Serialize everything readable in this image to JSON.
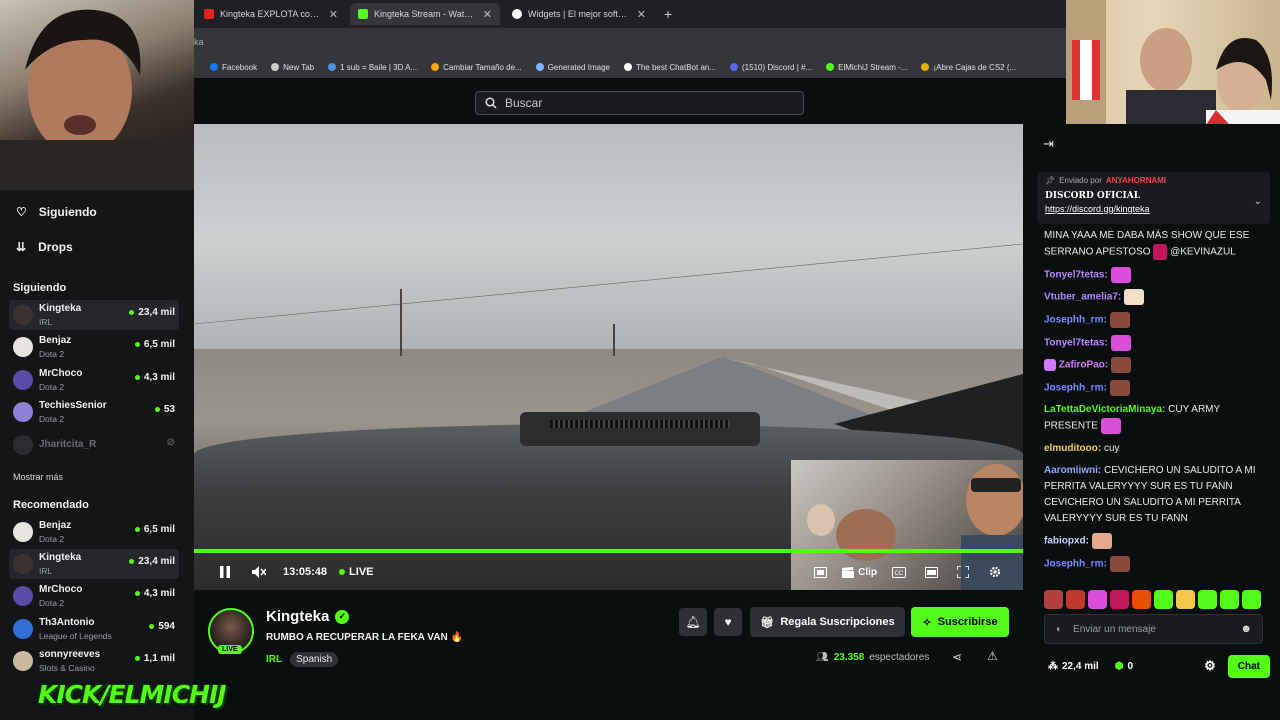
{
  "browser": {
    "tabs": [
      {
        "title": "Kingteka EXPLOTA con el Ñaja I",
        "favicon_color": "#e02424",
        "active": false
      },
      {
        "title": "Kingteka Stream - Watch Live o",
        "favicon_color": "#53fc18",
        "active": true
      },
      {
        "title": "Widgets | El mejor software par",
        "favicon_color": "#ffffff",
        "active": false
      }
    ],
    "url_fragment": "ka",
    "bookmarks": [
      {
        "label": "Facebook",
        "color": "#1877f2"
      },
      {
        "label": "New Tab",
        "color": "#cccccc"
      },
      {
        "label": "1 sub = Baile | 3D A...",
        "color": "#4a90e2"
      },
      {
        "label": "Cambiar Tamaño de...",
        "color": "#f2a900"
      },
      {
        "label": "Generated Image",
        "color": "#7fb2ff"
      },
      {
        "label": "The best ChatBot an...",
        "color": "#ffffff"
      },
      {
        "label": "(1510) Discord | #...",
        "color": "#5865f2"
      },
      {
        "label": "ElMichiJ Stream -...",
        "color": "#53fc18"
      },
      {
        "label": "¡Abre Cajas de CS2 (...",
        "color": "#e0b000"
      }
    ]
  },
  "search": {
    "placeholder": "Buscar"
  },
  "sidebar": {
    "following_label": "Siguiendo",
    "drops_label": "Drops",
    "following_section": "Siguiendo",
    "following": [
      {
        "name": "Kingteka",
        "category": "IRL",
        "viewers": "23,4 mil",
        "highlight": true,
        "online": true
      },
      {
        "name": "Benjaz",
        "category": "Dota 2",
        "viewers": "6,5 mil",
        "highlight": false,
        "online": true
      },
      {
        "name": "MrChoco",
        "category": "Dota 2",
        "viewers": "4,3 mil",
        "highlight": false,
        "online": true
      },
      {
        "name": "TechiesSenior",
        "category": "Dota 2",
        "viewers": "53",
        "highlight": false,
        "online": true
      },
      {
        "name": "Jharitcita_R",
        "category": "",
        "viewers": "",
        "highlight": false,
        "online": false
      }
    ],
    "show_more": "Mostrar más",
    "recommended_section": "Recomendado",
    "recommended": [
      {
        "name": "Benjaz",
        "category": "Dota 2",
        "viewers": "6,5 mil",
        "highlight": false
      },
      {
        "name": "Kingteka",
        "category": "IRL",
        "viewers": "23,4 mil",
        "highlight": true
      },
      {
        "name": "MrChoco",
        "category": "Dota 2",
        "viewers": "4,3 mil",
        "highlight": false
      },
      {
        "name": "Th3Antonio",
        "category": "League of Legends",
        "viewers": "594",
        "highlight": false
      },
      {
        "name": "sonnyreeves",
        "category": "Slots & Casino",
        "viewers": "1,1 mil",
        "highlight": false
      }
    ]
  },
  "overlay": {
    "kick_text": "KICK/ELMICHIJ"
  },
  "player": {
    "elapsed": "13:05:48",
    "live_label": "LIVE",
    "clip_label": "Clip",
    "progress_fraction": 1.0
  },
  "stream": {
    "streamer": "Kingteka",
    "live_badge": "LIVE",
    "title": "RUMBO A RECUPERAR LA FEKA VAN 🔥",
    "category": "IRL",
    "language": "Spanish",
    "gift_label": "Regala Suscripciones",
    "subscribe_label": "Suscribirse",
    "viewer_count": "23.358",
    "viewer_suffix": "espectadores"
  },
  "chat": {
    "pinned_by_prefix": "Enviado por",
    "pinned_by_user": "ANYAHORNAMI",
    "pinned_title": "DISCORD OFICIAL",
    "pinned_link": "https://discord.gg/kingteka",
    "messages": [
      {
        "user": "",
        "color": "#e8e8e8",
        "text": "MINA YAAA ME DABA MÁS SHOW QUE ESE SERRANO APESTOSO",
        "tail": "@KEVINAZUL",
        "emote": "#c2185b"
      },
      {
        "user": "Tonyel7tetas:",
        "color": "#b388ff",
        "text": "",
        "tail": "",
        "emote": "#d94fd8"
      },
      {
        "user": "Vtuber_amelia7:",
        "color": "#b388ff",
        "text": "",
        "tail": "",
        "emote": "#f2e0c9"
      },
      {
        "user": "Josephh_rm:",
        "color": "#7c8cff",
        "text": "",
        "tail": "",
        "emote": "#8a4a3a"
      },
      {
        "user": "Tonyel7tetas:",
        "color": "#b388ff",
        "text": "",
        "tail": "",
        "emote": "#d94fd8"
      },
      {
        "user": "ZafiroPao:",
        "color": "#d07bff",
        "text": "",
        "tail": "",
        "emote": "#8a4a3a"
      },
      {
        "user": "Josephh_rm:",
        "color": "#7c8cff",
        "text": "",
        "tail": "",
        "emote": "#8a4a3a"
      },
      {
        "user": "LaTettaDeVictoriaMinaya:",
        "color": "#53fc18",
        "text": "CUY ARMY PRESENTE",
        "tail": "",
        "emote": "#d94fd8"
      },
      {
        "user": "elmuditooo:",
        "color": "#f0d060",
        "text": "cuy",
        "tail": "",
        "emote": ""
      },
      {
        "user": "Aaromiiwni:",
        "color": "#8fa8ff",
        "text": "CEVICHERO UN SALUDITO A MI PERRITA VALERYYYY SUR ES TU FANN CEVICHERO UN SALUDITO A MI PERRITA VALERYYYY SUR ES TU FANN",
        "tail": "",
        "emote": ""
      },
      {
        "user": "fabiopxd:",
        "color": "#c7d2ff",
        "text": "",
        "tail": "",
        "emote": "#e7a890"
      },
      {
        "user": "Josephh_rm:",
        "color": "#7c8cff",
        "text": "",
        "tail": "",
        "emote": "#8a4a3a"
      }
    ],
    "emote_bar": [
      "#b0413e",
      "#c0392b",
      "#d94fd8",
      "#c2185b",
      "#e65100",
      "#53fc18",
      "#f2c94c",
      "#53fc18",
      "#53fc18",
      "#53fc18"
    ],
    "input_placeholder": "Enviar un mensaje",
    "points": "22,4 mil",
    "kick_points": "0",
    "chat_button": "Chat"
  }
}
